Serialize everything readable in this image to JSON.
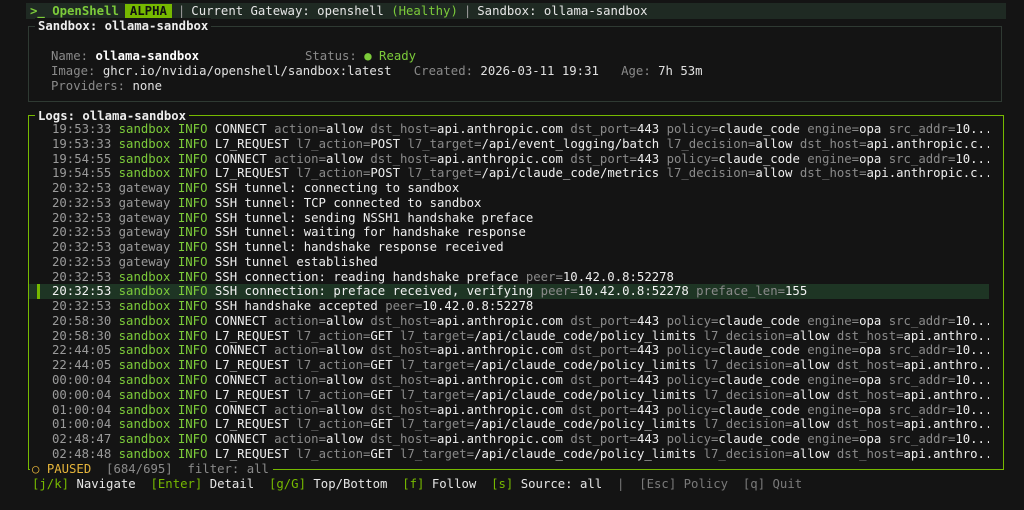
{
  "topbar": {
    "prompt": ">_",
    "brand": "OpenShell",
    "badge": "ALPHA",
    "gateway_label": "Current Gateway:",
    "gateway_name": "openshell",
    "gateway_status": "(Healthy)",
    "sandbox_label": "Sandbox:",
    "sandbox_name": "ollama-sandbox"
  },
  "sandbox": {
    "title": "Sandbox: ollama-sandbox",
    "name_label": "Name:",
    "name": "ollama-sandbox",
    "status_label": "Status:",
    "status_icon": "●",
    "status": "Ready",
    "image_label": "Image:",
    "image": "ghcr.io/nvidia/openshell/sandbox:latest",
    "created_label": "Created:",
    "created": "2026-03-11 19:31",
    "age_label": "Age:",
    "age": "7h 53m",
    "providers_label": "Providers:",
    "providers": "none"
  },
  "logs": {
    "title": "Logs: ollama-sandbox",
    "selected_index": 16,
    "rows": [
      {
        "time": "19:53:33",
        "source": "sandbox",
        "level": "INFO",
        "msg": "CONNECT",
        "kv": [
          [
            "action",
            "allow"
          ],
          [
            "dst_host",
            "api.anthropic.com"
          ],
          [
            "dst_port",
            "443"
          ],
          [
            "policy",
            "claude_code"
          ],
          [
            "engine",
            "opa"
          ],
          [
            "src_addr",
            "10..."
          ]
        ]
      },
      {
        "time": "19:53:33",
        "source": "sandbox",
        "level": "INFO",
        "msg": "L7_REQUEST",
        "kv": [
          [
            "l7_action",
            "POST"
          ],
          [
            "l7_target",
            "/api/event_logging/batch"
          ],
          [
            "l7_decision",
            "allow"
          ],
          [
            "dst_host",
            "api.anthropic.c..."
          ]
        ]
      },
      {
        "time": "19:54:55",
        "source": "sandbox",
        "level": "INFO",
        "msg": "CONNECT",
        "kv": [
          [
            "action",
            "allow"
          ],
          [
            "dst_host",
            "api.anthropic.com"
          ],
          [
            "dst_port",
            "443"
          ],
          [
            "policy",
            "claude_code"
          ],
          [
            "engine",
            "opa"
          ],
          [
            "src_addr",
            "10..."
          ]
        ]
      },
      {
        "time": "19:54:55",
        "source": "sandbox",
        "level": "INFO",
        "msg": "L7_REQUEST",
        "kv": [
          [
            "l7_action",
            "POST"
          ],
          [
            "l7_target",
            "/api/claude_code/metrics"
          ],
          [
            "l7_decision",
            "allow"
          ],
          [
            "dst_host",
            "api.anthropic.c..."
          ]
        ]
      },
      {
        "time": "20:32:53",
        "source": "gateway",
        "level": "INFO",
        "msg": "SSH tunnel: connecting to sandbox",
        "kv": []
      },
      {
        "time": "20:32:53",
        "source": "gateway",
        "level": "INFO",
        "msg": "SSH tunnel: TCP connected to sandbox",
        "kv": []
      },
      {
        "time": "20:32:53",
        "source": "gateway",
        "level": "INFO",
        "msg": "SSH tunnel: sending NSSH1 handshake preface",
        "kv": []
      },
      {
        "time": "20:32:53",
        "source": "gateway",
        "level": "INFO",
        "msg": "SSH tunnel: waiting for handshake response",
        "kv": []
      },
      {
        "time": "20:32:53",
        "source": "gateway",
        "level": "INFO",
        "msg": "SSH tunnel: handshake response received",
        "kv": []
      },
      {
        "time": "20:32:53",
        "source": "gateway",
        "level": "INFO",
        "msg": "SSH tunnel established",
        "kv": []
      },
      {
        "time": "20:32:53",
        "source": "sandbox",
        "level": "INFO",
        "msg": "SSH connection: reading handshake preface",
        "kv": [
          [
            "peer",
            "10.42.0.8:52278"
          ]
        ]
      },
      {
        "time": "20:32:53",
        "source": "sandbox",
        "level": "INFO",
        "msg": "SSH connection: preface received, verifying",
        "kv": [
          [
            "peer",
            "10.42.0.8:52278"
          ],
          [
            "preface_len",
            "155"
          ]
        ]
      },
      {
        "time": "20:32:53",
        "source": "sandbox",
        "level": "INFO",
        "msg": "SSH handshake accepted",
        "kv": [
          [
            "peer",
            "10.42.0.8:52278"
          ]
        ]
      },
      {
        "time": "20:58:30",
        "source": "sandbox",
        "level": "INFO",
        "msg": "CONNECT",
        "kv": [
          [
            "action",
            "allow"
          ],
          [
            "dst_host",
            "api.anthropic.com"
          ],
          [
            "dst_port",
            "443"
          ],
          [
            "policy",
            "claude_code"
          ],
          [
            "engine",
            "opa"
          ],
          [
            "src_addr",
            "10..."
          ]
        ]
      },
      {
        "time": "20:58:30",
        "source": "sandbox",
        "level": "INFO",
        "msg": "L7_REQUEST",
        "kv": [
          [
            "l7_action",
            "GET"
          ],
          [
            "l7_target",
            "/api/claude_code/policy_limits"
          ],
          [
            "l7_decision",
            "allow"
          ],
          [
            "dst_host",
            "api.anthro..."
          ]
        ]
      },
      {
        "time": "22:44:05",
        "source": "sandbox",
        "level": "INFO",
        "msg": "CONNECT",
        "kv": [
          [
            "action",
            "allow"
          ],
          [
            "dst_host",
            "api.anthropic.com"
          ],
          [
            "dst_port",
            "443"
          ],
          [
            "policy",
            "claude_code"
          ],
          [
            "engine",
            "opa"
          ],
          [
            "src_addr",
            "10..."
          ]
        ]
      },
      {
        "time": "22:44:05",
        "source": "sandbox",
        "level": "INFO",
        "msg": "L7_REQUEST",
        "kv": [
          [
            "l7_action",
            "GET"
          ],
          [
            "l7_target",
            "/api/claude_code/policy_limits"
          ],
          [
            "l7_decision",
            "allow"
          ],
          [
            "dst_host",
            "api.anthro..."
          ]
        ]
      },
      {
        "time": "00:00:04",
        "source": "sandbox",
        "level": "INFO",
        "msg": "CONNECT",
        "kv": [
          [
            "action",
            "allow"
          ],
          [
            "dst_host",
            "api.anthropic.com"
          ],
          [
            "dst_port",
            "443"
          ],
          [
            "policy",
            "claude_code"
          ],
          [
            "engine",
            "opa"
          ],
          [
            "src_addr",
            "10..."
          ]
        ]
      },
      {
        "time": "00:00:04",
        "source": "sandbox",
        "level": "INFO",
        "msg": "L7_REQUEST",
        "kv": [
          [
            "l7_action",
            "GET"
          ],
          [
            "l7_target",
            "/api/claude_code/policy_limits"
          ],
          [
            "l7_decision",
            "allow"
          ],
          [
            "dst_host",
            "api.anthro..."
          ]
        ]
      },
      {
        "time": "01:00:04",
        "source": "sandbox",
        "level": "INFO",
        "msg": "CONNECT",
        "kv": [
          [
            "action",
            "allow"
          ],
          [
            "dst_host",
            "api.anthropic.com"
          ],
          [
            "dst_port",
            "443"
          ],
          [
            "policy",
            "claude_code"
          ],
          [
            "engine",
            "opa"
          ],
          [
            "src_addr",
            "10..."
          ]
        ]
      },
      {
        "time": "01:00:04",
        "source": "sandbox",
        "level": "INFO",
        "msg": "L7_REQUEST",
        "kv": [
          [
            "l7_action",
            "GET"
          ],
          [
            "l7_target",
            "/api/claude_code/policy_limits"
          ],
          [
            "l7_decision",
            "allow"
          ],
          [
            "dst_host",
            "api.anthro..."
          ]
        ]
      },
      {
        "time": "02:48:47",
        "source": "sandbox",
        "level": "INFO",
        "msg": "CONNECT",
        "kv": [
          [
            "action",
            "allow"
          ],
          [
            "dst_host",
            "api.anthropic.com"
          ],
          [
            "dst_port",
            "443"
          ],
          [
            "policy",
            "claude_code"
          ],
          [
            "engine",
            "opa"
          ],
          [
            "src_addr",
            "10..."
          ]
        ]
      },
      {
        "time": "02:48:48",
        "source": "sandbox",
        "level": "INFO",
        "msg": "L7_REQUEST",
        "kv": [
          [
            "l7_action",
            "GET"
          ],
          [
            "l7_target",
            "/api/claude_code/policy_limits"
          ],
          [
            "l7_decision",
            "allow"
          ],
          [
            "dst_host",
            "api.anthro..."
          ]
        ]
      }
    ],
    "status": {
      "icon": "○",
      "state": "PAUSED",
      "position": "[684/695]",
      "filter_label": "filter:",
      "filter": "all"
    }
  },
  "footer": {
    "items": [
      {
        "key": "[j/k]",
        "label": "Navigate",
        "dim": false
      },
      {
        "key": "[Enter]",
        "label": "Detail",
        "dim": false
      },
      {
        "key": "[g/G]",
        "label": "Top/Bottom",
        "dim": false
      },
      {
        "key": "[f]",
        "label": "Follow",
        "dim": false
      },
      {
        "key": "[s]",
        "label": "Source:",
        "value": "all",
        "dim": false
      },
      {
        "key": "|",
        "label": "",
        "dim": true,
        "sep": true
      },
      {
        "key": "[Esc]",
        "label": "Policy",
        "dim": true
      },
      {
        "key": "[q]",
        "label": "Quit",
        "dim": true
      }
    ]
  },
  "colors": {
    "accent": "#76b900",
    "healthy": "#7ccb3a",
    "paused": "#e5b43a",
    "background": "#141414"
  }
}
